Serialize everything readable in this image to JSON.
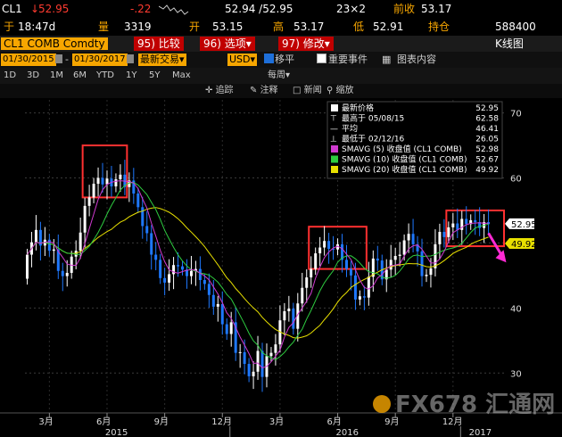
{
  "quote": {
    "ticker": "CL1",
    "last": "52.95",
    "change": "-.22",
    "bid_ask": "52.94 /52.95",
    "size": "23×2",
    "prev_close_label": "前收",
    "prev_close": "53.17",
    "time_label": "于",
    "time": "18:47d",
    "volume_label": "量",
    "volume": "3319",
    "open_label": "开",
    "open": "53.15",
    "high_label": "高",
    "high": "53.17",
    "low_label": "低",
    "low": "52.91",
    "oi_label": "持仓",
    "oi": "588400"
  },
  "toolbar": {
    "security": "CL1 COMB Comdty",
    "btn95": "95) 比较",
    "btn96": "96) 选项",
    "btn97": "97) 修改",
    "caret": "▾",
    "chart_type": "K线图"
  },
  "range": {
    "start": "01/30/2015",
    "end": "01/30/2017",
    "period": "最新交易",
    "currency": "USD",
    "shift_label": "移平",
    "events_label": "重要事件",
    "table_label": "图表内容"
  },
  "timeframes": [
    "1D",
    "3D",
    "1M",
    "6M",
    "YTD",
    "1Y",
    "5Y",
    "Max"
  ],
  "freq": "每周",
  "draw_tools": {
    "track": "追踪",
    "note": "注释",
    "news": "新闻",
    "zoom": "缩放"
  },
  "legend": {
    "items": [
      {
        "label": "最新价格",
        "value": "52.95",
        "icon": "white-square"
      },
      {
        "label": "最高于 05/08/15",
        "value": "62.58",
        "icon": "high-marker"
      },
      {
        "label": "平均",
        "value": "46.41",
        "icon": "average-marker"
      },
      {
        "label": "最低于 02/12/16",
        "value": "26.05",
        "icon": "low-marker"
      },
      {
        "label": "SMAVG (5) 收盘值 (CL1 COMB)",
        "value": "52.98",
        "color": "#d03ad0"
      },
      {
        "label": "SMAVG (10) 收盘值 (CL1 COMB)",
        "value": "52.67",
        "color": "#2ecc40"
      },
      {
        "label": "SMAVG (20) 收盘值 (CL1 COMB)",
        "value": "49.92",
        "color": "#e8e000"
      }
    ]
  },
  "price_tags": {
    "last": "52.95",
    "sma20": "49.92"
  },
  "watermark": "FX678 汇通网",
  "colors": {
    "up": "#ffffff",
    "down": "#1e78ff",
    "sma5": "#d03ad0",
    "sma10": "#2ecc40",
    "sma20": "#e8e000",
    "highlight_box": "#ff3030",
    "arrow": "#ff2ad4"
  },
  "chart_data": {
    "type": "candlestick",
    "frequency": "weekly",
    "yaxis": {
      "ticks": [
        "30",
        "40",
        "50",
        "60",
        "70"
      ],
      "range": [
        24,
        72
      ],
      "side": "right"
    },
    "xaxis": {
      "month_ticks": [
        {
          "label": "3月",
          "week": 5
        },
        {
          "label": "6月",
          "week": 18
        },
        {
          "label": "9月",
          "week": 31
        },
        {
          "label": "12月",
          "week": 44
        },
        {
          "label": "3月",
          "week": 57
        },
        {
          "label": "6月",
          "week": 70
        },
        {
          "label": "9月",
          "week": 83
        },
        {
          "label": "12月",
          "week": 96
        }
      ],
      "year_ticks": [
        {
          "label": "2015",
          "week": 20
        },
        {
          "label": "2016",
          "week": 72
        },
        {
          "label": "2017",
          "week": 102
        }
      ]
    },
    "highlight_boxes": [
      {
        "week_from": 13,
        "week_to": 22,
        "low": 57,
        "high": 65
      },
      {
        "week_from": 64,
        "week_to": 76,
        "low": 46,
        "high": 52.5
      },
      {
        "week_from": 95,
        "week_to": 107,
        "low": 49.5,
        "high": 55
      }
    ],
    "arrow": {
      "week_from": 104,
      "value_from": 51.5,
      "week_to": 108,
      "value_to": 47
    },
    "closes": [
      48.2,
      50.1,
      52.0,
      49.6,
      50.5,
      48.8,
      49.0,
      45.7,
      44.9,
      45.4,
      47.9,
      48.8,
      51.6,
      55.7,
      57.0,
      59.1,
      60.0,
      59.0,
      59.9,
      58.7,
      59.8,
      60.5,
      58.6,
      59.6,
      57.6,
      55.5,
      52.6,
      51.5,
      48.2,
      47.4,
      44.6,
      43.9,
      45.2,
      46.6,
      46.4,
      45.9,
      44.9,
      45.7,
      46.0,
      44.3,
      43.7,
      42.0,
      40.2,
      40.6,
      37.5,
      36.0,
      37.8,
      33.1,
      33.2,
      31.4,
      29.5,
      30.2,
      33.4,
      29.4,
      32.6,
      33.1,
      34.4,
      38.1,
      39.5,
      39.9,
      36.8,
      40.7,
      43.1,
      44.7,
      46.0,
      48.4,
      49.3,
      50.3,
      49.1,
      49.0,
      49.8,
      47.4,
      46.0,
      45.0,
      41.3,
      41.8,
      41.6,
      44.8,
      47.6,
      47.3,
      44.4,
      45.9,
      47.4,
      48.0,
      48.2,
      50.4,
      51.4,
      49.8,
      48.7,
      44.9,
      45.1,
      46.1,
      49.8,
      51.7,
      50.9,
      52.4,
      53.0,
      52.0,
      53.7,
      52.9,
      53.5,
      53.2,
      52.3,
      53.2,
      52.9
    ],
    "opens": [
      44.5,
      48.2,
      50.1,
      52.0,
      49.6,
      50.5,
      48.8,
      49.0,
      45.7,
      44.9,
      45.4,
      47.9,
      48.8,
      51.6,
      55.7,
      57.0,
      59.1,
      60.0,
      59.0,
      59.9,
      58.7,
      59.8,
      60.5,
      58.6,
      59.6,
      57.6,
      55.5,
      52.6,
      51.5,
      48.2,
      47.4,
      44.6,
      43.9,
      45.2,
      46.6,
      46.4,
      45.9,
      44.9,
      45.7,
      46.0,
      44.3,
      43.7,
      42.0,
      40.2,
      40.6,
      37.5,
      36.0,
      37.8,
      33.1,
      33.2,
      31.4,
      29.5,
      30.2,
      33.4,
      29.4,
      32.6,
      33.1,
      34.4,
      38.1,
      39.5,
      39.9,
      36.8,
      40.7,
      43.1,
      44.7,
      46.0,
      48.4,
      49.3,
      50.3,
      49.1,
      49.0,
      49.8,
      47.4,
      46.0,
      45.0,
      41.3,
      41.8,
      41.6,
      44.8,
      47.6,
      47.3,
      44.4,
      45.9,
      47.4,
      48.0,
      48.2,
      50.4,
      51.4,
      49.8,
      48.7,
      44.9,
      45.1,
      46.1,
      49.8,
      51.7,
      50.9,
      52.4,
      53.0,
      52.0,
      53.7,
      52.9,
      53.5,
      53.2,
      52.3,
      53.2
    ]
  }
}
